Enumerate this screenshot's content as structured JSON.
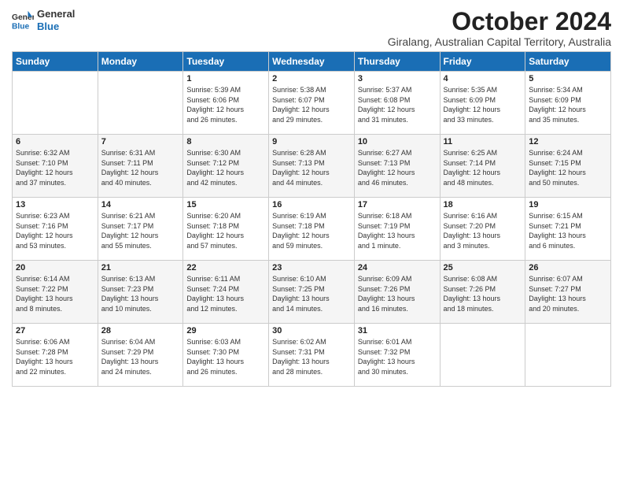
{
  "logo": {
    "line1": "General",
    "line2": "Blue"
  },
  "header": {
    "title": "October 2024",
    "subtitle": "Giralang, Australian Capital Territory, Australia"
  },
  "days_of_week": [
    "Sunday",
    "Monday",
    "Tuesday",
    "Wednesday",
    "Thursday",
    "Friday",
    "Saturday"
  ],
  "weeks": [
    [
      {
        "day": "",
        "info": ""
      },
      {
        "day": "",
        "info": ""
      },
      {
        "day": "1",
        "info": "Sunrise: 5:39 AM\nSunset: 6:06 PM\nDaylight: 12 hours\nand 26 minutes."
      },
      {
        "day": "2",
        "info": "Sunrise: 5:38 AM\nSunset: 6:07 PM\nDaylight: 12 hours\nand 29 minutes."
      },
      {
        "day": "3",
        "info": "Sunrise: 5:37 AM\nSunset: 6:08 PM\nDaylight: 12 hours\nand 31 minutes."
      },
      {
        "day": "4",
        "info": "Sunrise: 5:35 AM\nSunset: 6:09 PM\nDaylight: 12 hours\nand 33 minutes."
      },
      {
        "day": "5",
        "info": "Sunrise: 5:34 AM\nSunset: 6:09 PM\nDaylight: 12 hours\nand 35 minutes."
      }
    ],
    [
      {
        "day": "6",
        "info": "Sunrise: 6:32 AM\nSunset: 7:10 PM\nDaylight: 12 hours\nand 37 minutes."
      },
      {
        "day": "7",
        "info": "Sunrise: 6:31 AM\nSunset: 7:11 PM\nDaylight: 12 hours\nand 40 minutes."
      },
      {
        "day": "8",
        "info": "Sunrise: 6:30 AM\nSunset: 7:12 PM\nDaylight: 12 hours\nand 42 minutes."
      },
      {
        "day": "9",
        "info": "Sunrise: 6:28 AM\nSunset: 7:13 PM\nDaylight: 12 hours\nand 44 minutes."
      },
      {
        "day": "10",
        "info": "Sunrise: 6:27 AM\nSunset: 7:13 PM\nDaylight: 12 hours\nand 46 minutes."
      },
      {
        "day": "11",
        "info": "Sunrise: 6:25 AM\nSunset: 7:14 PM\nDaylight: 12 hours\nand 48 minutes."
      },
      {
        "day": "12",
        "info": "Sunrise: 6:24 AM\nSunset: 7:15 PM\nDaylight: 12 hours\nand 50 minutes."
      }
    ],
    [
      {
        "day": "13",
        "info": "Sunrise: 6:23 AM\nSunset: 7:16 PM\nDaylight: 12 hours\nand 53 minutes."
      },
      {
        "day": "14",
        "info": "Sunrise: 6:21 AM\nSunset: 7:17 PM\nDaylight: 12 hours\nand 55 minutes."
      },
      {
        "day": "15",
        "info": "Sunrise: 6:20 AM\nSunset: 7:18 PM\nDaylight: 12 hours\nand 57 minutes."
      },
      {
        "day": "16",
        "info": "Sunrise: 6:19 AM\nSunset: 7:18 PM\nDaylight: 12 hours\nand 59 minutes."
      },
      {
        "day": "17",
        "info": "Sunrise: 6:18 AM\nSunset: 7:19 PM\nDaylight: 13 hours\nand 1 minute."
      },
      {
        "day": "18",
        "info": "Sunrise: 6:16 AM\nSunset: 7:20 PM\nDaylight: 13 hours\nand 3 minutes."
      },
      {
        "day": "19",
        "info": "Sunrise: 6:15 AM\nSunset: 7:21 PM\nDaylight: 13 hours\nand 6 minutes."
      }
    ],
    [
      {
        "day": "20",
        "info": "Sunrise: 6:14 AM\nSunset: 7:22 PM\nDaylight: 13 hours\nand 8 minutes."
      },
      {
        "day": "21",
        "info": "Sunrise: 6:13 AM\nSunset: 7:23 PM\nDaylight: 13 hours\nand 10 minutes."
      },
      {
        "day": "22",
        "info": "Sunrise: 6:11 AM\nSunset: 7:24 PM\nDaylight: 13 hours\nand 12 minutes."
      },
      {
        "day": "23",
        "info": "Sunrise: 6:10 AM\nSunset: 7:25 PM\nDaylight: 13 hours\nand 14 minutes."
      },
      {
        "day": "24",
        "info": "Sunrise: 6:09 AM\nSunset: 7:26 PM\nDaylight: 13 hours\nand 16 minutes."
      },
      {
        "day": "25",
        "info": "Sunrise: 6:08 AM\nSunset: 7:26 PM\nDaylight: 13 hours\nand 18 minutes."
      },
      {
        "day": "26",
        "info": "Sunrise: 6:07 AM\nSunset: 7:27 PM\nDaylight: 13 hours\nand 20 minutes."
      }
    ],
    [
      {
        "day": "27",
        "info": "Sunrise: 6:06 AM\nSunset: 7:28 PM\nDaylight: 13 hours\nand 22 minutes."
      },
      {
        "day": "28",
        "info": "Sunrise: 6:04 AM\nSunset: 7:29 PM\nDaylight: 13 hours\nand 24 minutes."
      },
      {
        "day": "29",
        "info": "Sunrise: 6:03 AM\nSunset: 7:30 PM\nDaylight: 13 hours\nand 26 minutes."
      },
      {
        "day": "30",
        "info": "Sunrise: 6:02 AM\nSunset: 7:31 PM\nDaylight: 13 hours\nand 28 minutes."
      },
      {
        "day": "31",
        "info": "Sunrise: 6:01 AM\nSunset: 7:32 PM\nDaylight: 13 hours\nand 30 minutes."
      },
      {
        "day": "",
        "info": ""
      },
      {
        "day": "",
        "info": ""
      }
    ]
  ]
}
